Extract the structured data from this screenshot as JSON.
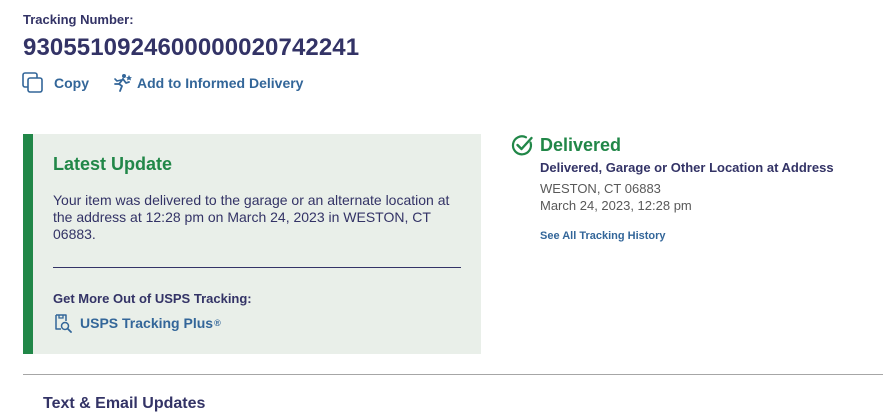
{
  "tracking": {
    "label": "Tracking Number:",
    "number": "9305510924600000020742241"
  },
  "actions": {
    "copy_label": "Copy",
    "informed_label": "Add to Informed Delivery"
  },
  "latest_update": {
    "title": "Latest Update",
    "text": "Your item was delivered to the garage or an alternate location at the address at 12:28 pm on March 24, 2023 in WESTON, CT 06883.",
    "more_title": "Get More Out of USPS Tracking:",
    "plus_label": "USPS Tracking Plus",
    "plus_mark": "®"
  },
  "status": {
    "title": "Delivered",
    "detail": "Delivered, Garage or Other Location at Address",
    "location": "WESTON, CT 06883",
    "date": "March 24, 2023, 12:28 pm",
    "history_link": "See All Tracking History"
  },
  "text_email": {
    "title": "Text & Email Updates"
  },
  "icons": {
    "copy": "copy-icon",
    "informed": "runner-icon",
    "plus": "tracking-plus-icon",
    "delivered": "check-circle-icon"
  },
  "colors": {
    "navy": "#333366",
    "link": "#336699",
    "green": "#218748",
    "panel_bg": "#e9efe9"
  }
}
